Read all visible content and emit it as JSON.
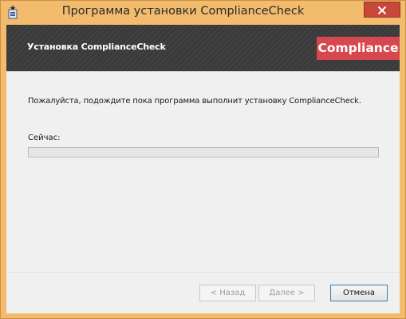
{
  "window": {
    "title": "Программа установки ComplianceCheck"
  },
  "banner": {
    "title": "Установка ComplianceCheck",
    "logo_text": "Compliance"
  },
  "main": {
    "message": "Пожалуйста, подождите пока программа выполнит установку ComplianceCheck.",
    "status_label": "Сейчас:",
    "progress": 0
  },
  "buttons": {
    "back": "< Назад",
    "next": "Далее >",
    "cancel": "Отмена"
  },
  "colors": {
    "titlebar": "#f2bb6d",
    "close_button": "#c7473b",
    "banner": "#3a3a3a",
    "logo": "#d7474f",
    "dialog_background": "#f0f0f0",
    "default_button_border": "#3c7fb1"
  },
  "icons": {
    "app": "installer-icon",
    "close": "close-icon"
  }
}
